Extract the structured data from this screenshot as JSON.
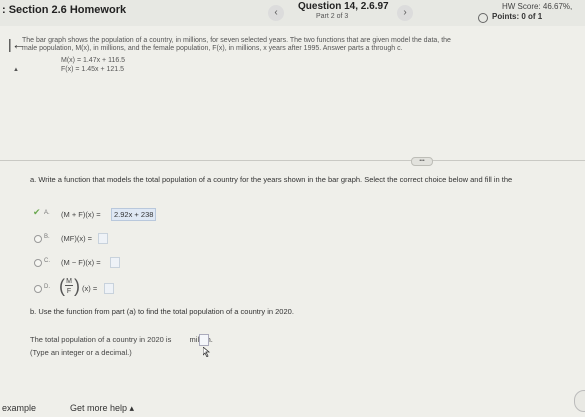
{
  "header": {
    "section_title": ": Section 2.6 Homework",
    "prev_icon": "‹",
    "question_title": "Question 14, 2.6.97",
    "next_icon": "›",
    "part": "Part 2 of 3",
    "hw_score": "HW Score: 46.67%,",
    "points": "Points: 0 of 1"
  },
  "problem": {
    "back_icon": "|←",
    "line1": "The bar graph shows the population of a country, in millions, for seven selected years. The two functions that are given model the data, the",
    "line2": "male population, M(x), in millions, and the female population, F(x), in millions, x years after 1995. Answer parts a through c.",
    "m_func": "M(x) = 1.47x + 116.5",
    "f_func": "F(x) = 1.45x + 121.5",
    "mark": "▲"
  },
  "more_label": "•••",
  "part_a": {
    "prompt": "a. Write a function that models the total population of a country for the years shown in the bar graph. Select the correct choice below and fill in the",
    "options": [
      {
        "letter": "A.",
        "expr": "(M + F)(x) =",
        "answer": "2.92x + 238",
        "selected": true
      },
      {
        "letter": "B.",
        "expr": "(MF)(x) =",
        "answer": "",
        "selected": false
      },
      {
        "letter": "C.",
        "expr": "(M − F)(x) =",
        "answer": "",
        "selected": false
      },
      {
        "letter": "D.",
        "frac_num": "M",
        "frac_den": "F",
        "expr_tail": "(x) =",
        "answer": "",
        "selected": false
      }
    ]
  },
  "part_b": {
    "prompt": "b. Use the function from part (a) to find the total population of a country in 2020.",
    "line_prefix": "The total population of a country in 2020 is",
    "line_suffix": "million.",
    "hint": "(Type an integer or a decimal.)"
  },
  "footer": {
    "example": "example",
    "help": "Get more help ▴"
  }
}
